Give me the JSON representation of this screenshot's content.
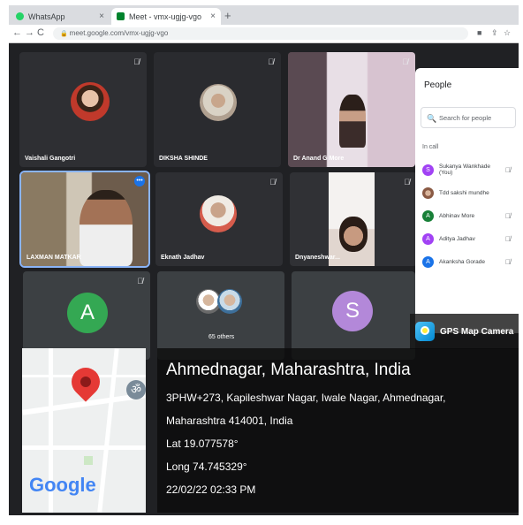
{
  "browser": {
    "tabs": [
      {
        "label": "WhatsApp",
        "close": "×"
      },
      {
        "label": "Meet - vmx-ugjg-vgo",
        "close": "×"
      }
    ],
    "new_tab": "+",
    "url": "meet.google.com/vmx-ugjg-vgo"
  },
  "meet": {
    "tiles": [
      {
        "name": "Vaishali Gangotri"
      },
      {
        "name": "DIKSHA SHINDE"
      },
      {
        "name": "Dr Anand G More"
      },
      {
        "name": "LAXMAN MATKAR"
      },
      {
        "name": "Eknath Jadhav"
      },
      {
        "name": "Dnyaneshwar..."
      },
      {
        "name": "",
        "letter": "A"
      },
      {
        "name": "65 others"
      },
      {
        "name": "",
        "letter": "S"
      }
    ],
    "colors": {
      "letter_a": "#34a853",
      "letter_s": "#b388d9",
      "highlight": "#8ab4f8"
    }
  },
  "people_panel": {
    "title": "People",
    "search_placeholder": "Search for people",
    "section": "In call",
    "people": [
      {
        "initial": "S",
        "name": "Sukanya Wankhade (You)",
        "color": "#a142f4"
      },
      {
        "initial": "",
        "name": "Tdd sakshi mundhe",
        "color": "#8a5a44"
      },
      {
        "initial": "A",
        "name": "Abhinav More",
        "color": "#188038"
      },
      {
        "initial": "A",
        "name": "Aditya Jadhav",
        "color": "#a142f4"
      },
      {
        "initial": "A",
        "name": "Akanksha Gorade",
        "color": "#1a73e8"
      }
    ]
  },
  "gps": {
    "app_name": "GPS Map Camera",
    "location": "Ahmednagar, Maharashtra, India",
    "address_line1": "3PHW+273, Kapileshwar Nagar, Iwale Nagar, Ahmednagar,",
    "address_line2": "Maharashtra 414001, India",
    "lat": "Lat 19.077578°",
    "long": "Long 74.745329°",
    "datetime": "22/02/22 02:33 PM",
    "map_logo": "Google"
  }
}
